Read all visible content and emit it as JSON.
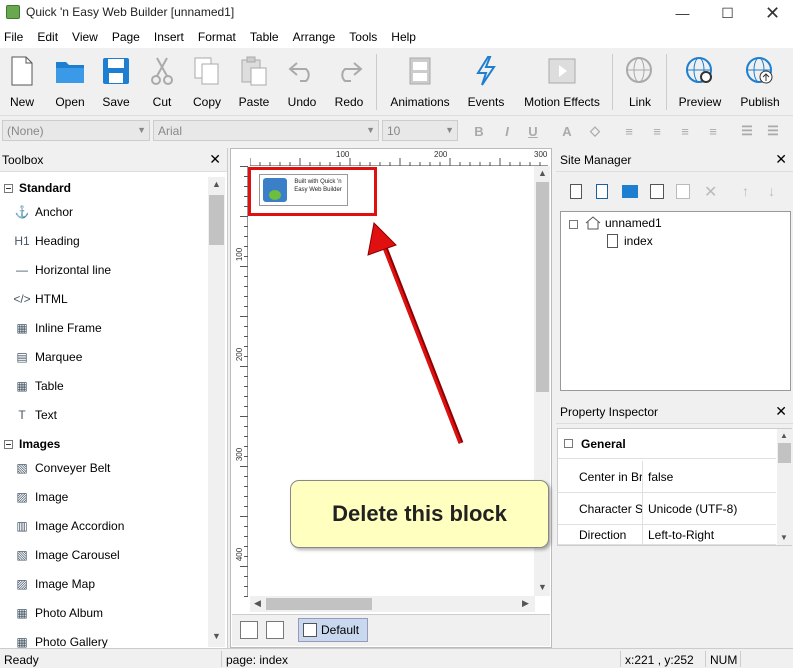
{
  "window": {
    "title": "Quick 'n Easy Web Builder [unnamed1]"
  },
  "menu": [
    "File",
    "Edit",
    "View",
    "Page",
    "Insert",
    "Format",
    "Table",
    "Arrange",
    "Tools",
    "Help"
  ],
  "toolbar": {
    "buttons": [
      {
        "label": "New",
        "icon": "new-page-icon"
      },
      {
        "label": "Open",
        "icon": "folder-icon"
      },
      {
        "label": "Save",
        "icon": "floppy-icon"
      },
      {
        "label": "Cut",
        "icon": "scissors-icon"
      },
      {
        "label": "Copy",
        "icon": "copy-icon"
      },
      {
        "label": "Paste",
        "icon": "paste-icon"
      },
      {
        "label": "Undo",
        "icon": "undo-icon"
      },
      {
        "label": "Redo",
        "icon": "redo-icon"
      },
      {
        "label": "Animations",
        "icon": "film-icon"
      },
      {
        "label": "Events",
        "icon": "lightning-icon"
      },
      {
        "label": "Motion Effects",
        "icon": "motion-icon"
      },
      {
        "label": "Link",
        "icon": "globe-link-icon"
      },
      {
        "label": "Preview",
        "icon": "globe-search-icon"
      },
      {
        "label": "Publish",
        "icon": "globe-upload-icon"
      }
    ]
  },
  "format": {
    "style": "(None)",
    "font": "Arial",
    "size": "10"
  },
  "toolbox": {
    "title": "Toolbox",
    "categories": [
      {
        "name": "Standard",
        "items": [
          {
            "label": "Anchor",
            "icon": "anchor-icon",
            "glyph": "⚓"
          },
          {
            "label": "Heading",
            "icon": "heading-icon",
            "glyph": "H1"
          },
          {
            "label": "Horizontal line",
            "icon": "horizontal-line-icon",
            "glyph": "—"
          },
          {
            "label": "HTML",
            "icon": "html-icon",
            "glyph": "</>"
          },
          {
            "label": "Inline Frame",
            "icon": "inline-frame-icon",
            "glyph": "▦"
          },
          {
            "label": "Marquee",
            "icon": "marquee-icon",
            "glyph": "▤"
          },
          {
            "label": "Table",
            "icon": "table-icon",
            "glyph": "▦"
          },
          {
            "label": "Text",
            "icon": "text-icon",
            "glyph": "T"
          }
        ]
      },
      {
        "name": "Images",
        "items": [
          {
            "label": "Conveyer Belt",
            "icon": "conveyer-belt-icon",
            "glyph": "▧"
          },
          {
            "label": "Image",
            "icon": "image-icon",
            "glyph": "▨"
          },
          {
            "label": "Image Accordion",
            "icon": "image-accordion-icon",
            "glyph": "▥"
          },
          {
            "label": "Image Carousel",
            "icon": "image-carousel-icon",
            "glyph": "▧"
          },
          {
            "label": "Image Map",
            "icon": "image-map-icon",
            "glyph": "▨"
          },
          {
            "label": "Photo Album",
            "icon": "photo-album-icon",
            "glyph": "▦"
          },
          {
            "label": "Photo Gallery",
            "icon": "photo-gallery-icon",
            "glyph": "▦"
          }
        ]
      }
    ]
  },
  "ruler": {
    "top": [
      "100",
      "200",
      "300"
    ],
    "left": [
      "100",
      "200",
      "300",
      "400"
    ]
  },
  "canvas": {
    "logo_text": "Built with Quick 'n Easy Web Builder",
    "page_tab": "Default"
  },
  "callout": {
    "text": "Delete this block"
  },
  "site_manager": {
    "title": "Site Manager",
    "root": "unnamed1",
    "pages": [
      "index"
    ]
  },
  "property_inspector": {
    "title": "Property Inspector",
    "section": "General",
    "rows": [
      {
        "key": "Center in Br",
        "value": "false"
      },
      {
        "key": "Character S",
        "value": "Unicode (UTF-8)"
      },
      {
        "key": "Direction",
        "value": "Left-to-Right"
      }
    ]
  },
  "status": {
    "left": "Ready",
    "page": "page: index",
    "coords": "x:221 , y:252",
    "num": "NUM"
  }
}
